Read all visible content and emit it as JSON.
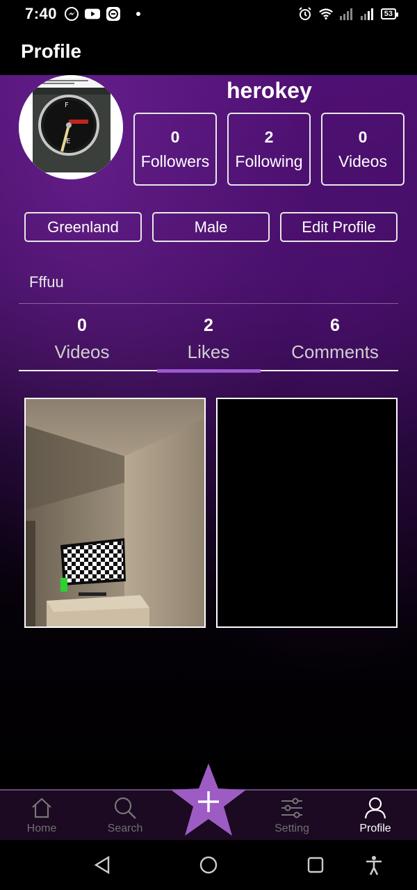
{
  "status_bar": {
    "time": "7:40",
    "battery": "53"
  },
  "header": {
    "title": "Profile"
  },
  "profile": {
    "username": "herokey",
    "stats": [
      {
        "value": "0",
        "label": "Followers"
      },
      {
        "value": "2",
        "label": "Following"
      },
      {
        "value": "0",
        "label": "Videos"
      }
    ],
    "pills": {
      "location": "Greenland",
      "gender": "Male",
      "edit": "Edit Profile"
    },
    "bio": "Fffuu"
  },
  "tabs": [
    {
      "value": "0",
      "label": "Videos"
    },
    {
      "value": "2",
      "label": "Likes"
    },
    {
      "value": "6",
      "label": "Comments"
    }
  ],
  "active_tab": "Likes",
  "bottom_nav": {
    "home": "Home",
    "search": "Search",
    "setting": "Setting",
    "profile": "Profile"
  },
  "colors": {
    "accent": "#9b59d0",
    "star": "#9d5cc4",
    "profile_bg_top": "#4b0f6e"
  }
}
